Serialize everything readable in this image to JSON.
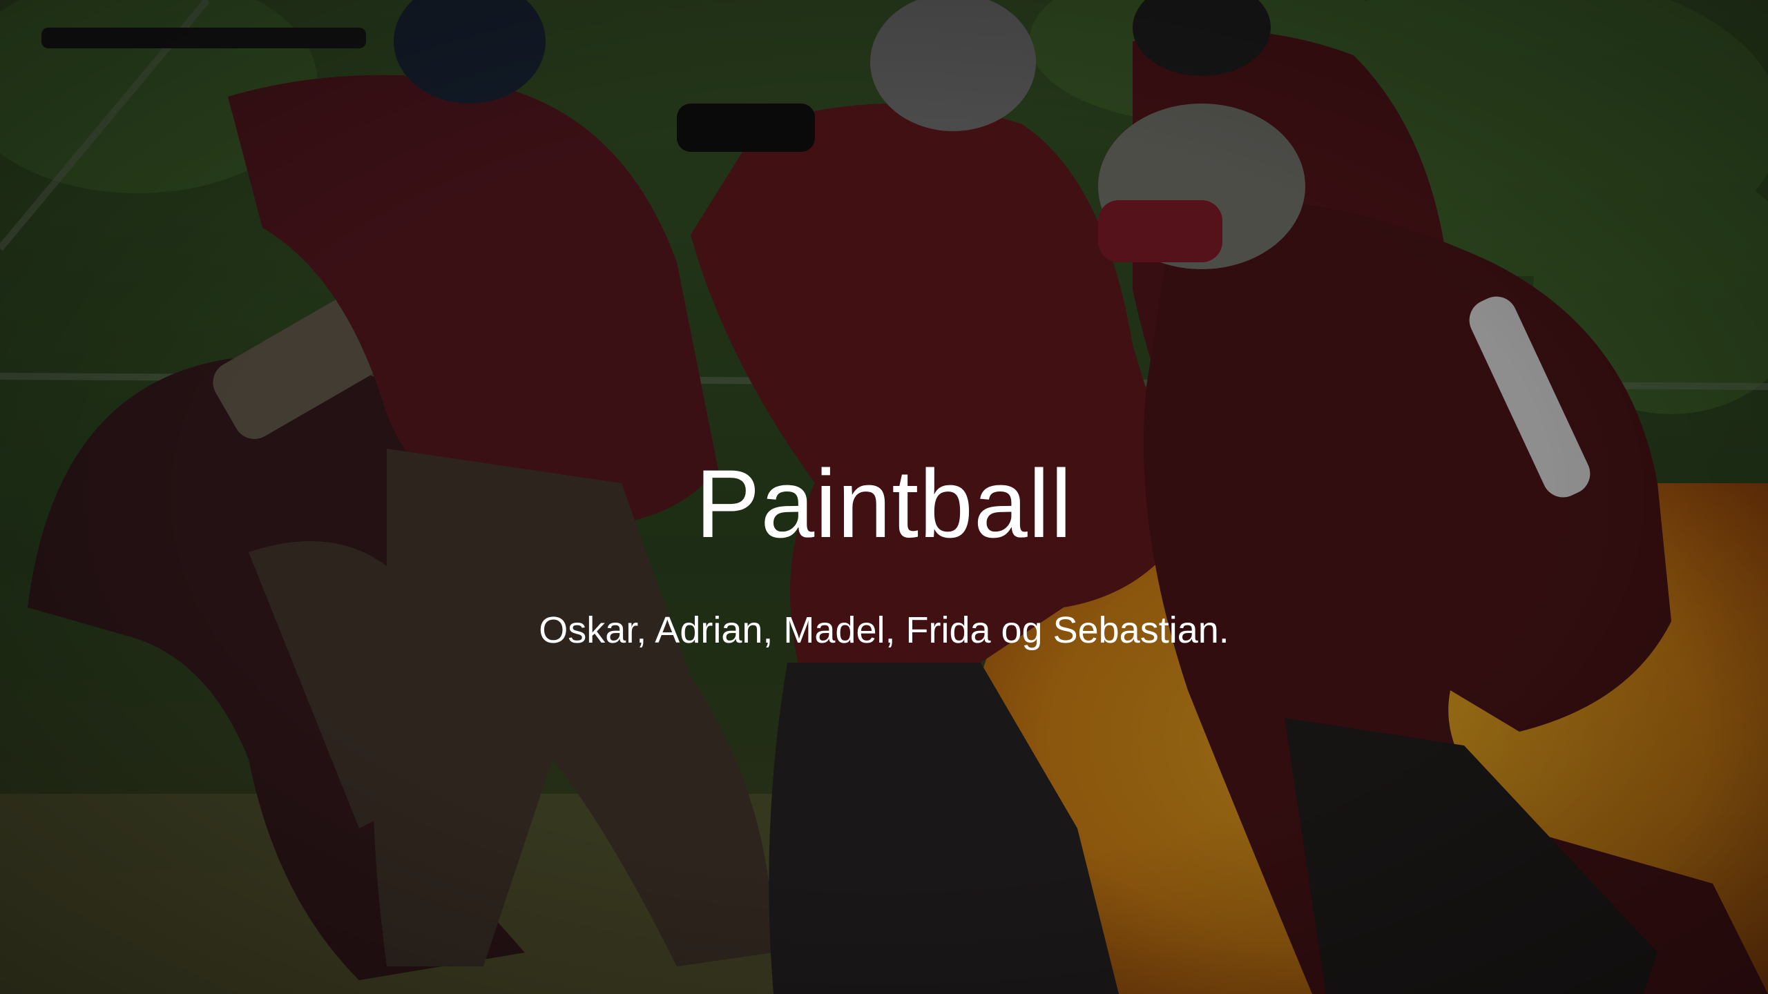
{
  "slide": {
    "title": "Paintball",
    "subtitle": "Oskar, Adrian, Madel, Frida og Sebastian."
  },
  "background": {
    "overlay_color": "#000000"
  }
}
